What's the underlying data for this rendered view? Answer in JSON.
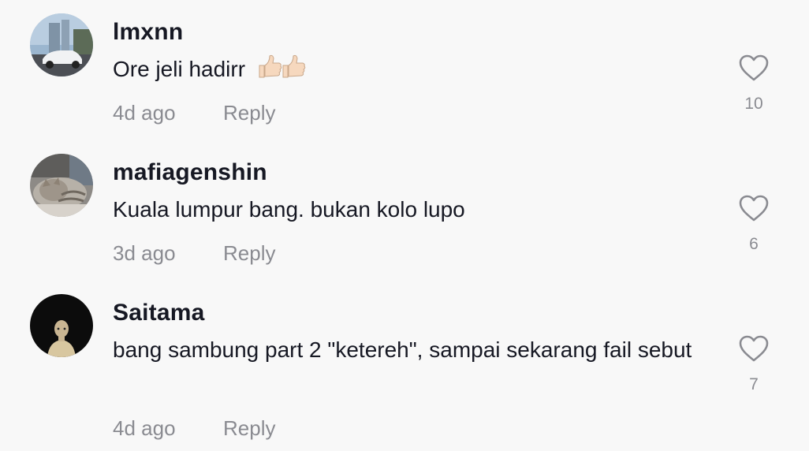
{
  "comments": [
    {
      "username": "lmxnn",
      "text": "Ore jeli hadirr",
      "emoji": "thumbs-up-icons",
      "time": "4d ago",
      "reply": "Reply",
      "likes": "10",
      "avatar_icon": "car-avatar"
    },
    {
      "username": "mafiagenshin",
      "text": "Kuala lumpur bang. bukan kolo lupo",
      "time": "3d ago",
      "reply": "Reply",
      "likes": "6",
      "avatar_icon": "cat-avatar"
    },
    {
      "username": "Saitama",
      "text": "bang sambung part 2 \"ketereh\", sampai sekarang fail sebut",
      "time": "4d ago",
      "reply": "Reply",
      "likes": "7",
      "avatar_icon": "saitama-avatar"
    }
  ],
  "colors": {
    "background": "#f8f8f8",
    "text": "#161823",
    "muted": "#8a8b91"
  }
}
